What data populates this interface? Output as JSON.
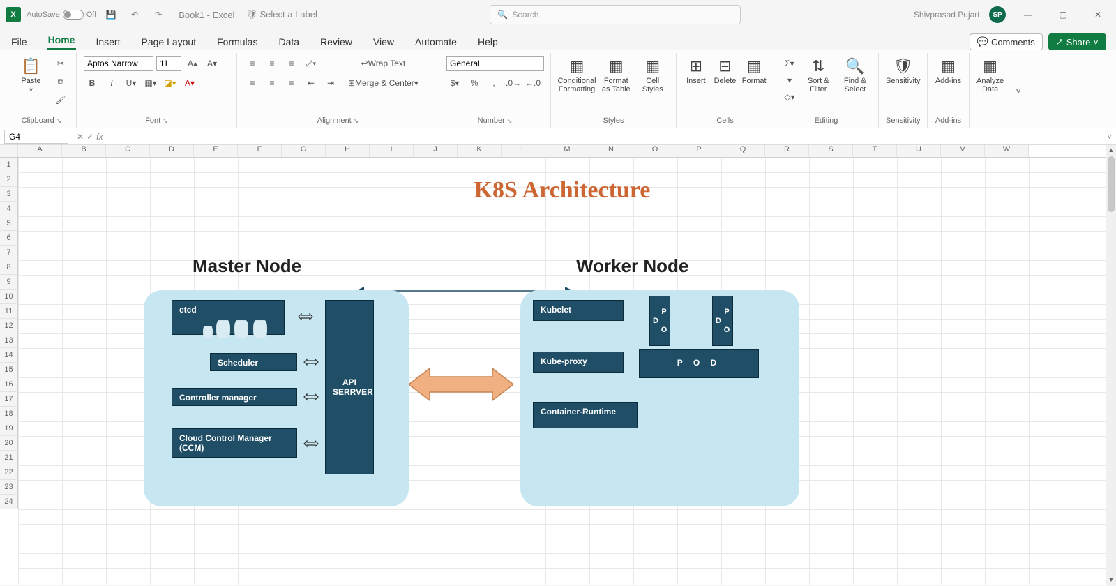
{
  "titlebar": {
    "autosave_label": "AutoSave",
    "autosave_state": "Off",
    "doc_title": "Book1 - Excel",
    "label_select": "Select a Label",
    "search_placeholder": "Search",
    "user_name": "Shivprasad Pujari",
    "user_initials": "SP"
  },
  "tabs": {
    "file": "File",
    "home": "Home",
    "insert": "Insert",
    "page_layout": "Page Layout",
    "formulas": "Formulas",
    "data": "Data",
    "review": "Review",
    "view": "View",
    "automate": "Automate",
    "help": "Help",
    "comments": "Comments",
    "share": "Share"
  },
  "ribbon": {
    "paste": "Paste",
    "clipboard_group": "Clipboard",
    "font_name": "Aptos Narrow",
    "font_size": "11",
    "font_group": "Font",
    "wrap_text": "Wrap Text",
    "merge_center": "Merge & Center",
    "alignment_group": "Alignment",
    "num_format": "General",
    "number_group": "Number",
    "cond_fmt": "Conditional Formatting",
    "fmt_table": "Format as Table",
    "cell_styles": "Cell Styles",
    "styles_group": "Styles",
    "insert": "Insert",
    "delete": "Delete",
    "format": "Format",
    "cells_group": "Cells",
    "sort_filter": "Sort & Filter",
    "find_select": "Find & Select",
    "editing_group": "Editing",
    "sensitivity": "Sensitivity",
    "sensitivity_group": "Sensitivity",
    "addins": "Add-ins",
    "addins_group": "Add-ins",
    "analyze": "Analyze Data"
  },
  "formula_bar": {
    "cell_ref": "G4",
    "fx": "fx"
  },
  "grid": {
    "columns": [
      "A",
      "B",
      "C",
      "D",
      "E",
      "F",
      "G",
      "H",
      "I",
      "J",
      "K",
      "L",
      "M",
      "N",
      "O",
      "P",
      "Q",
      "R",
      "S",
      "T",
      "U",
      "V",
      "W"
    ],
    "rows": [
      "1",
      "2",
      "3",
      "4",
      "5",
      "6",
      "7",
      "8",
      "9",
      "10",
      "11",
      "12",
      "13",
      "14",
      "15",
      "16",
      "17",
      "18",
      "19",
      "20",
      "21",
      "22",
      "23",
      "24"
    ]
  },
  "diagram": {
    "title": "K8S Architecture",
    "master_label": "Master Node",
    "worker_label": "Worker Node",
    "etcd": "etcd",
    "scheduler": "Scheduler",
    "controller": "Controller manager",
    "ccm": "Cloud  Control Manager (CCM)",
    "api": "API SERRVER",
    "kubelet": "Kubelet",
    "kubeproxy": "Kube-proxy",
    "container_runtime": "Container-Runtime",
    "pod_small1": "P O D",
    "pod_small2": "P O D",
    "pod_big": "P  O  D"
  }
}
